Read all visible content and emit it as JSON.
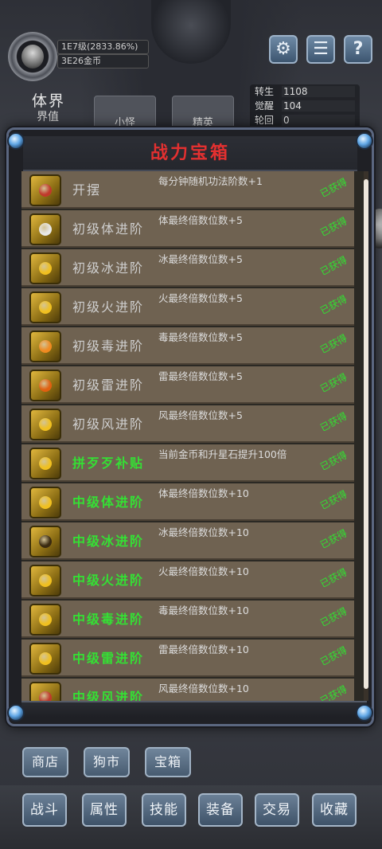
{
  "header": {
    "exp_text": "1E7级(2833.86%)",
    "gold_text": "3E26金币",
    "realm_title": "体界",
    "realm_value_label": "界值",
    "buttons": [
      {
        "name": "settings",
        "icon": "gear-icon",
        "glyph": "⚙"
      },
      {
        "name": "menu",
        "icon": "menu-icon",
        "glyph": "☰"
      },
      {
        "name": "help",
        "icon": "help-icon",
        "glyph": "?"
      }
    ],
    "stats": [
      {
        "label": "转生",
        "value": "1108"
      },
      {
        "label": "觉醒",
        "value": "104"
      },
      {
        "label": "轮回",
        "value": "0"
      }
    ],
    "tabs": [
      "小怪",
      "精英"
    ]
  },
  "modal": {
    "title": "战力宝箱",
    "title_color": "#e33030",
    "items": [
      {
        "name": "开摆",
        "desc": "每分钟随机功法阶数+1",
        "status": "已获得",
        "highlight": false,
        "gem": "#c0392b"
      },
      {
        "name": "初级体进阶",
        "desc": "体最终倍数位数+5",
        "status": "已获得",
        "highlight": false,
        "gem": "#e8e8e8"
      },
      {
        "name": "初级冰进阶",
        "desc": "冰最终倍数位数+5",
        "status": "已获得",
        "highlight": false,
        "gem": "#f0c020"
      },
      {
        "name": "初级火进阶",
        "desc": "火最终倍数位数+5",
        "status": "已获得",
        "highlight": false,
        "gem": "#f0c020"
      },
      {
        "name": "初级毒进阶",
        "desc": "毒最终倍数位数+5",
        "status": "已获得",
        "highlight": false,
        "gem": "#f08a20"
      },
      {
        "name": "初级雷进阶",
        "desc": "雷最终倍数位数+5",
        "status": "已获得",
        "highlight": false,
        "gem": "#e06010"
      },
      {
        "name": "初级风进阶",
        "desc": "风最终倍数位数+5",
        "status": "已获得",
        "highlight": false,
        "gem": "#f0c020"
      },
      {
        "name": "拼歹歹补贴",
        "desc": "当前金币和升星石提升100倍",
        "status": "已获得",
        "highlight": true,
        "gem": "#f0c020"
      },
      {
        "name": "中级体进阶",
        "desc": "体最终倍数位数+10",
        "status": "已获得",
        "highlight": true,
        "gem": "#f0c020"
      },
      {
        "name": "中级冰进阶",
        "desc": "冰最终倍数位数+10",
        "status": "已获得",
        "highlight": true,
        "gem": "#3a2a10"
      },
      {
        "name": "中级火进阶",
        "desc": "火最终倍数位数+10",
        "status": "已获得",
        "highlight": true,
        "gem": "#f0c020"
      },
      {
        "name": "中级毒进阶",
        "desc": "毒最终倍数位数+10",
        "status": "已获得",
        "highlight": true,
        "gem": "#f0c020"
      },
      {
        "name": "中级雷进阶",
        "desc": "雷最终倍数位数+10",
        "status": "已获得",
        "highlight": true,
        "gem": "#f0c020"
      },
      {
        "name": "中级风进阶",
        "desc": "风最终倍数位数+10",
        "status": "已获得",
        "highlight": true,
        "gem": "#c0392b"
      }
    ]
  },
  "sub_nav": [
    "商店",
    "狗市",
    "宝箱"
  ],
  "main_nav": [
    "战斗",
    "属性",
    "技能",
    "装备",
    "交易",
    "收藏"
  ],
  "colors": {
    "highlight_green": "#34e034",
    "row_bg": "#6f6251",
    "button_blue": "#5a6f86"
  }
}
